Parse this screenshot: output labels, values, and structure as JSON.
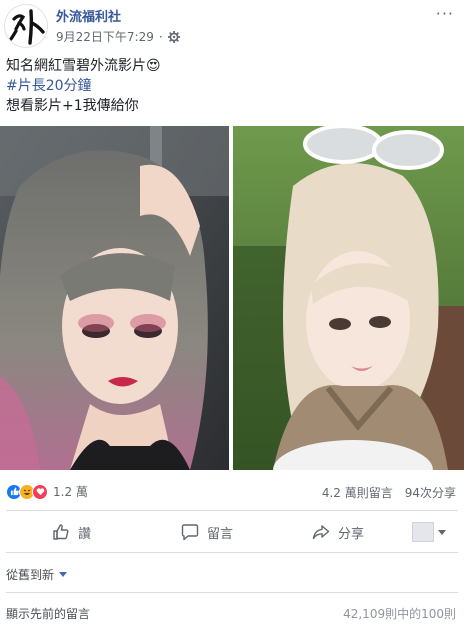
{
  "post": {
    "page_name": "外流福利社",
    "avatar_char": "外",
    "timestamp": "9月22日下午7:29",
    "privacy_icon": "gear-icon",
    "more_icon": "more-icon",
    "more_glyph": "···",
    "lines": {
      "line1": "知名網紅雪碧外流影片",
      "line1_emoji": "😍",
      "hashtag": "#片長20分鐘",
      "line3": "想看影片+1我傳給你"
    }
  },
  "stats": {
    "reaction_icons": [
      "like-icon",
      "haha-icon",
      "love-icon"
    ],
    "reaction_count": "1.2 萬",
    "comment_count": "4.2 萬則留言",
    "share_count": "94次分享"
  },
  "actions": {
    "like_label": "讚",
    "comment_label": "留言",
    "share_label": "分享"
  },
  "comments": {
    "sort_label": "從舊到新",
    "previous_label": "顯示先前的留言",
    "previous_count": "42,109則中的100則"
  },
  "colors": {
    "link_blue": "#365899",
    "like_blue": "#1877f2",
    "love_red": "#f33e58",
    "haha_yellow": "#f7b125"
  }
}
